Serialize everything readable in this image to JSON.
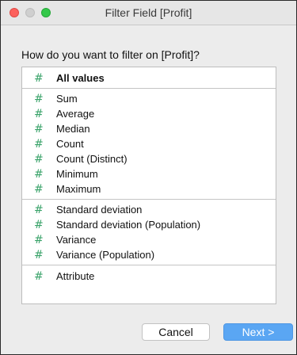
{
  "window": {
    "title": "Filter Field [Profit]"
  },
  "prompt": "How do you want to filter on [Profit]?",
  "list": {
    "icon": "hash-icon",
    "groups": [
      {
        "items": [
          {
            "label": "All values",
            "bold": true
          }
        ]
      },
      {
        "items": [
          {
            "label": "Sum"
          },
          {
            "label": "Average"
          },
          {
            "label": "Median"
          },
          {
            "label": "Count"
          },
          {
            "label": "Count (Distinct)"
          },
          {
            "label": "Minimum"
          },
          {
            "label": "Maximum"
          }
        ]
      },
      {
        "items": [
          {
            "label": "Standard deviation"
          },
          {
            "label": "Standard deviation (Population)"
          },
          {
            "label": "Variance"
          },
          {
            "label": "Variance (Population)"
          }
        ]
      },
      {
        "items": [
          {
            "label": "Attribute"
          }
        ]
      }
    ]
  },
  "buttons": {
    "cancel": "Cancel",
    "next": "Next >"
  },
  "colors": {
    "hash": "#3aa36a",
    "primary": "#5aa6f3"
  }
}
